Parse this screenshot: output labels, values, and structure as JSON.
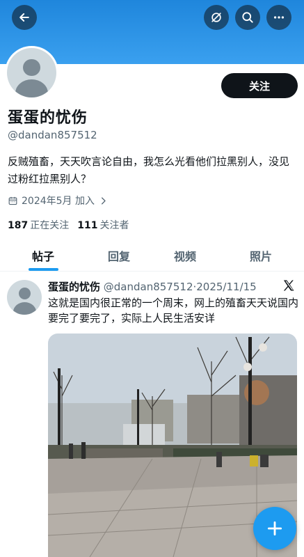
{
  "header": {
    "back_icon": "arrow-left-icon",
    "grok_icon": "grok-icon",
    "search_icon": "search-icon",
    "more_icon": "more-horizontal-icon"
  },
  "profile": {
    "follow_label": "关注",
    "name": "蛋蛋的忧伤",
    "handle": "@dandan857512",
    "bio": "反贼殖畜，天天吹言论自由，我怎么光看他们拉黑别人，没见过粉红拉黑别人？",
    "joined": "2024年5月 加入",
    "following_count": "187",
    "following_label": "正在关注",
    "followers_count": "111",
    "followers_label": "关注者"
  },
  "tabs": [
    {
      "label": "帖子",
      "active": true
    },
    {
      "label": "回复",
      "active": false
    },
    {
      "label": "视频",
      "active": false
    },
    {
      "label": "照片",
      "active": false
    }
  ],
  "post": {
    "name": "蛋蛋的忧伤",
    "meta": " @dandan857512·2025/11/15",
    "text": "这就是国内很正常的一个周末，网上的殖畜天天说国内要完了要完了，实际上人民生活安详",
    "media_icon": "video-thumbnail"
  },
  "fab": {
    "icon": "plus-icon"
  },
  "colors": {
    "accent": "#1d9bf0",
    "banner": "#2f95e6",
    "text": "#0f1419",
    "muted": "#536471"
  }
}
